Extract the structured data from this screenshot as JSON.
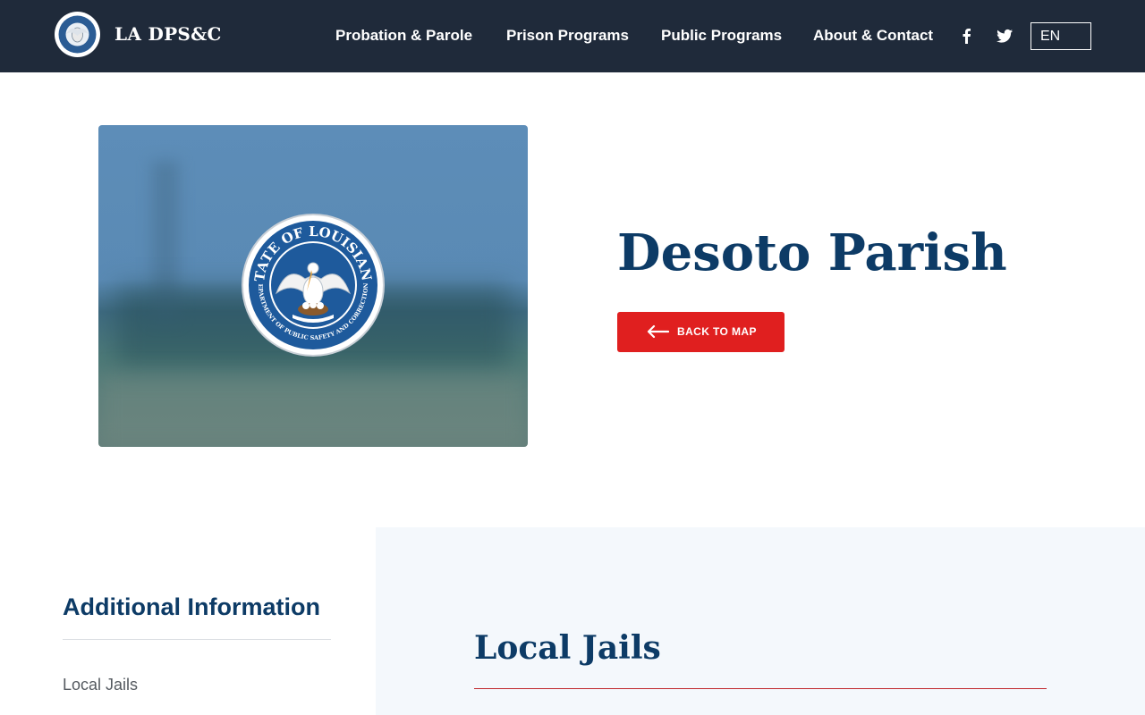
{
  "header": {
    "brand": "LA DPS&C",
    "nav": [
      {
        "label": "Probation & Parole"
      },
      {
        "label": "Prison Programs"
      },
      {
        "label": "Public Programs"
      },
      {
        "label": "About & Contact"
      }
    ],
    "social": [
      "facebook-icon",
      "twitter-icon"
    ],
    "language": "EN",
    "background_color": "#1f2a3a"
  },
  "hero": {
    "title": "Desoto Parish",
    "back_button_label": "BACK TO MAP",
    "button_color": "#e01f1f",
    "title_color": "#0d3b66"
  },
  "sidebar": {
    "heading": "Additional Information",
    "links": [
      {
        "label": "Local Jails"
      }
    ]
  },
  "content": {
    "heading": "Local Jails",
    "rule_color": "#c0282d"
  }
}
